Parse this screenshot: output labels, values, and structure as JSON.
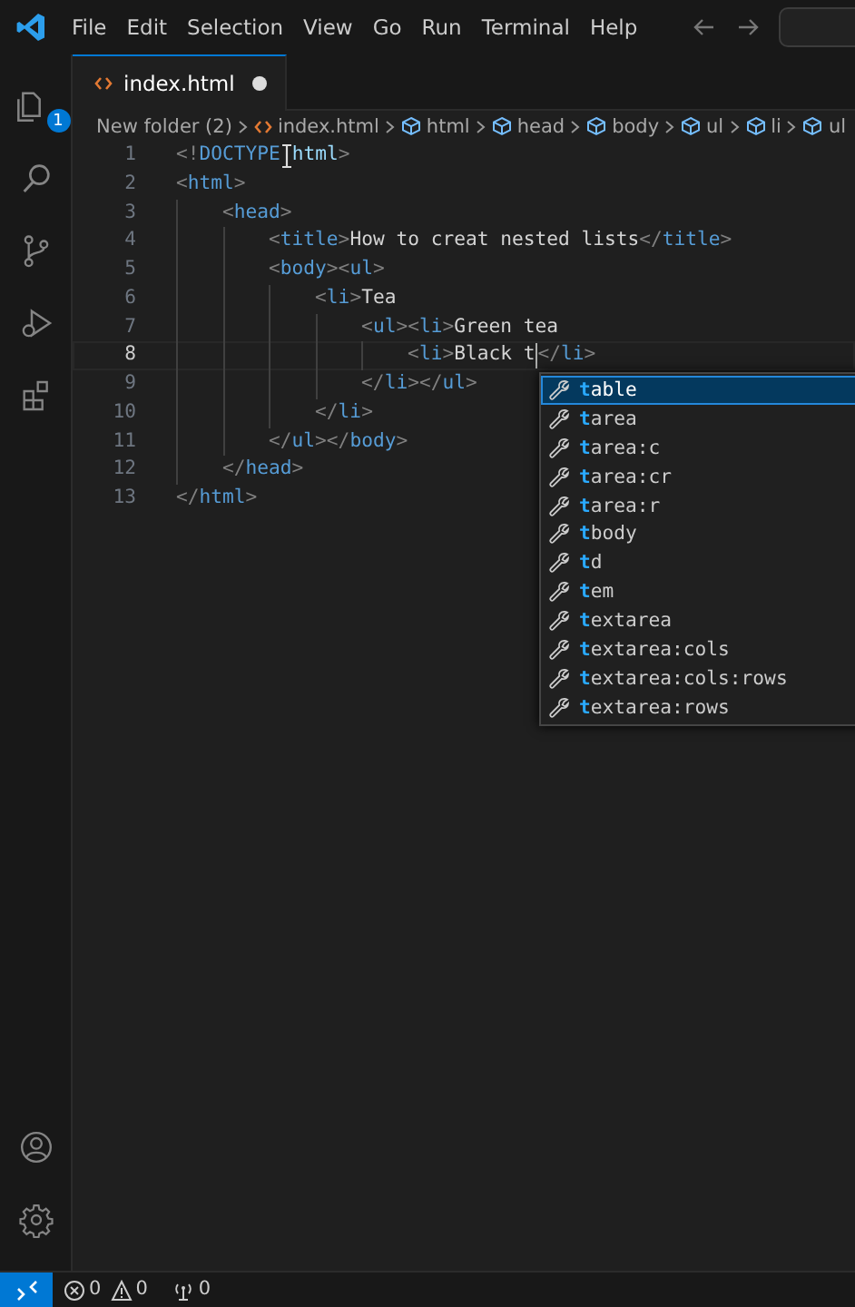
{
  "menu": [
    "File",
    "Edit",
    "Selection",
    "View",
    "Go",
    "Run",
    "Terminal",
    "Help"
  ],
  "activity_bar": [
    {
      "kind": "explorer",
      "badge": "1"
    },
    {
      "kind": "search"
    },
    {
      "kind": "source-control"
    },
    {
      "kind": "run"
    },
    {
      "kind": "extensions"
    }
  ],
  "activity_bottom": [
    {
      "kind": "account"
    },
    {
      "kind": "settings"
    }
  ],
  "tabs": [
    {
      "label": "index.html",
      "selected": true,
      "modified": true
    }
  ],
  "breadcrumb": [
    {
      "kind": "folder",
      "label": "New folder (2)"
    },
    {
      "kind": "file",
      "label": "index.html"
    },
    {
      "kind": "element",
      "label": "html"
    },
    {
      "kind": "element",
      "label": "head"
    },
    {
      "kind": "element",
      "label": "body"
    },
    {
      "kind": "element",
      "label": "ul"
    },
    {
      "kind": "element",
      "label": "li"
    },
    {
      "kind": "element",
      "label": "ul"
    }
  ],
  "editor": {
    "lines": [
      {
        "number": "1",
        "current": false,
        "tokens": [
          {
            "kind": "punct",
            "text": "<!"
          },
          {
            "kind": "tag",
            "text": "DOCTYPE"
          },
          {
            "kind": "mouse"
          },
          {
            "kind": "attr",
            "text": "html"
          },
          {
            "kind": "punct",
            "text": ">"
          }
        ]
      },
      {
        "number": "2",
        "current": false,
        "tokens": [
          {
            "kind": "punct",
            "text": "<"
          },
          {
            "kind": "tag",
            "text": "html"
          },
          {
            "kind": "punct",
            "text": ">"
          }
        ]
      },
      {
        "number": "3",
        "current": false,
        "tokens": [
          {
            "kind": "punct",
            "text": "    <"
          },
          {
            "kind": "tag",
            "text": "head"
          },
          {
            "kind": "punct",
            "text": ">"
          }
        ]
      },
      {
        "number": "4",
        "current": false,
        "tokens": [
          {
            "kind": "punct",
            "text": "        <"
          },
          {
            "kind": "tag",
            "text": "title"
          },
          {
            "kind": "punct",
            "text": ">"
          },
          {
            "kind": "text",
            "text": "How to creat nested lists"
          },
          {
            "kind": "punct",
            "text": "</"
          },
          {
            "kind": "tag",
            "text": "title"
          },
          {
            "kind": "punct",
            "text": ">"
          }
        ]
      },
      {
        "number": "5",
        "current": false,
        "tokens": [
          {
            "kind": "punct",
            "text": "        <"
          },
          {
            "kind": "tag",
            "text": "body"
          },
          {
            "kind": "punct",
            "text": "><"
          },
          {
            "kind": "tag",
            "text": "ul"
          },
          {
            "kind": "punct",
            "text": ">"
          }
        ]
      },
      {
        "number": "6",
        "current": false,
        "tokens": [
          {
            "kind": "punct",
            "text": "            <"
          },
          {
            "kind": "tag",
            "text": "li"
          },
          {
            "kind": "punct",
            "text": ">"
          },
          {
            "kind": "text",
            "text": "Tea"
          }
        ]
      },
      {
        "number": "7",
        "current": false,
        "tokens": [
          {
            "kind": "punct",
            "text": "                <"
          },
          {
            "kind": "tag",
            "text": "ul"
          },
          {
            "kind": "punct",
            "text": "><"
          },
          {
            "kind": "tag",
            "text": "li"
          },
          {
            "kind": "punct",
            "text": ">"
          },
          {
            "kind": "text",
            "text": "Green tea"
          }
        ]
      },
      {
        "number": "8",
        "current": true,
        "tokens": [
          {
            "kind": "punct",
            "text": "                    <"
          },
          {
            "kind": "tag",
            "text": "li"
          },
          {
            "kind": "punct",
            "text": ">"
          },
          {
            "kind": "text",
            "text": "Black t"
          },
          {
            "kind": "cursor"
          },
          {
            "kind": "punct",
            "text": "</"
          },
          {
            "kind": "tag",
            "text": "li"
          },
          {
            "kind": "punct",
            "text": ">"
          }
        ]
      },
      {
        "number": "9",
        "current": false,
        "tokens": [
          {
            "kind": "punct",
            "text": "                </"
          },
          {
            "kind": "tag",
            "text": "li"
          },
          {
            "kind": "punct",
            "text": "></"
          },
          {
            "kind": "tag",
            "text": "ul"
          },
          {
            "kind": "punct",
            "text": ">"
          }
        ]
      },
      {
        "number": "10",
        "current": false,
        "tokens": [
          {
            "kind": "punct",
            "text": "            </"
          },
          {
            "kind": "tag",
            "text": "li"
          },
          {
            "kind": "punct",
            "text": ">"
          }
        ]
      },
      {
        "number": "11",
        "current": false,
        "tokens": [
          {
            "kind": "punct",
            "text": "        </"
          },
          {
            "kind": "tag",
            "text": "ul"
          },
          {
            "kind": "punct",
            "text": "></"
          },
          {
            "kind": "tag",
            "text": "body"
          },
          {
            "kind": "punct",
            "text": ">"
          }
        ]
      },
      {
        "number": "12",
        "current": false,
        "tokens": [
          {
            "kind": "punct",
            "text": "    </"
          },
          {
            "kind": "tag",
            "text": "head"
          },
          {
            "kind": "punct",
            "text": ">"
          }
        ]
      },
      {
        "number": "13",
        "current": false,
        "tokens": [
          {
            "kind": "punct",
            "text": "</"
          },
          {
            "kind": "tag",
            "text": "html"
          },
          {
            "kind": "punct",
            "text": ">"
          }
        ]
      }
    ]
  },
  "suggest": {
    "items": [
      {
        "match": "t",
        "rest": "able",
        "selected": true
      },
      {
        "match": "t",
        "rest": "area",
        "selected": false
      },
      {
        "match": "t",
        "rest": "area:c",
        "selected": false
      },
      {
        "match": "t",
        "rest": "area:cr",
        "selected": false
      },
      {
        "match": "t",
        "rest": "area:r",
        "selected": false
      },
      {
        "match": "t",
        "rest": "body",
        "selected": false
      },
      {
        "match": "t",
        "rest": "d",
        "selected": false
      },
      {
        "match": "t",
        "rest": "em",
        "selected": false
      },
      {
        "match": "t",
        "rest": "extarea",
        "selected": false
      },
      {
        "match": "t",
        "rest": "extarea:cols",
        "selected": false
      },
      {
        "match": "t",
        "rest": "extarea:cols:rows",
        "selected": false
      },
      {
        "match": "t",
        "rest": "extarea:rows",
        "selected": false
      }
    ]
  },
  "status_bar": {
    "errors": "0",
    "warnings": "0",
    "ports": "0"
  }
}
